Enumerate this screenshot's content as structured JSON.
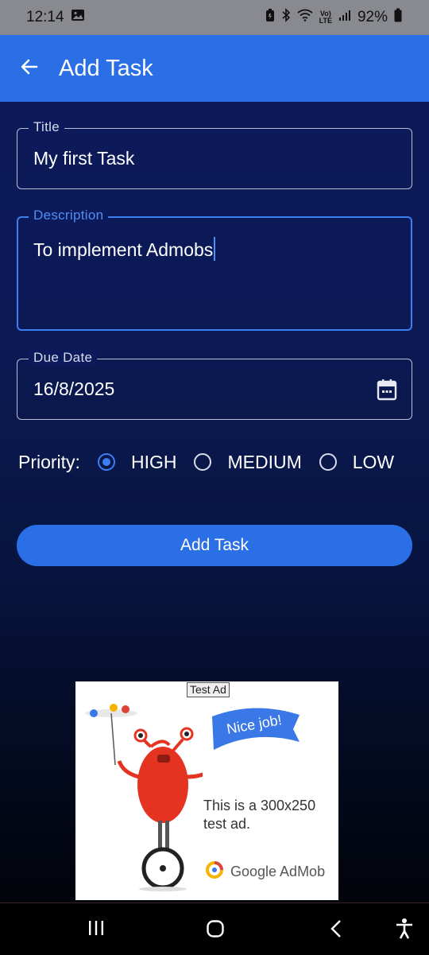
{
  "status_bar": {
    "time": "12:14",
    "battery_percent": "92%",
    "network_label": "LTE"
  },
  "app_bar": {
    "title": "Add Task",
    "back_icon": "arrow-left-icon"
  },
  "form": {
    "title_field": {
      "label": "Title",
      "value": "My first Task"
    },
    "description_field": {
      "label": "Description",
      "value": "To implement Admobs"
    },
    "due_date_field": {
      "label": "Due Date",
      "value": "16/8/2025",
      "icon": "calendar-icon"
    },
    "priority": {
      "label": "Priority:",
      "options": [
        "HIGH",
        "MEDIUM",
        "LOW"
      ],
      "selected": "HIGH"
    },
    "submit_label": "Add Task"
  },
  "ad": {
    "badge": "Test Ad",
    "flag_text": "Nice job!",
    "body": "This is a 300x250 test ad.",
    "brand": "Google AdMob"
  },
  "colors": {
    "accent": "#2a6fe6",
    "focus": "#3b7ff0",
    "background_top": "#0c1a5c",
    "background_bottom": "#02040c"
  }
}
